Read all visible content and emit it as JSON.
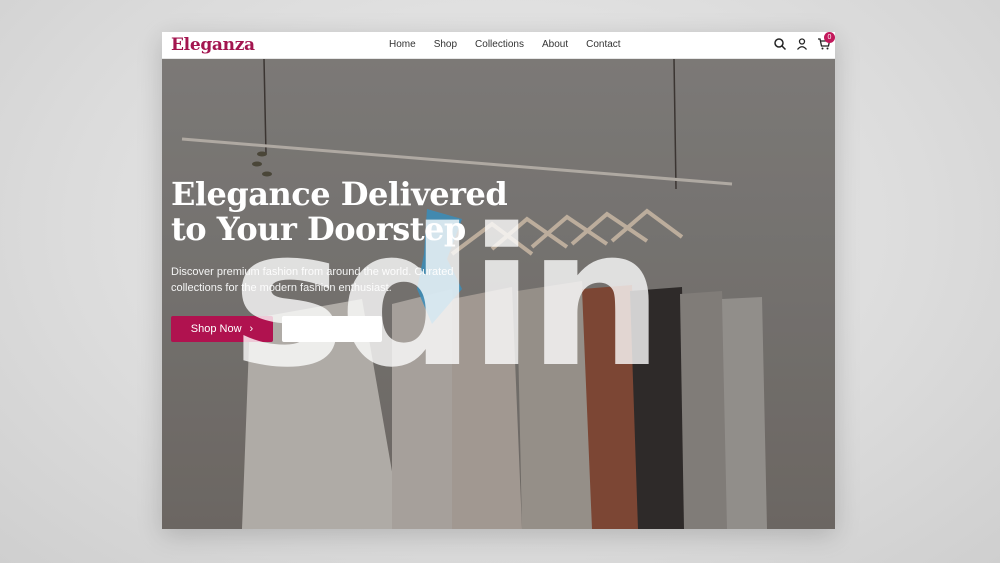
{
  "brand": {
    "name": "Eleganza",
    "color": "#a3154f"
  },
  "nav": {
    "items": [
      "Home",
      "Shop",
      "Collections",
      "About",
      "Contact"
    ],
    "icons": [
      "search-icon",
      "user-icon",
      "cart-icon"
    ],
    "cart_count": "0"
  },
  "hero": {
    "headline": "Elegance Delivered to Your Doorstep",
    "subtext": "Discover premium fashion from around the world. Curated collections for the modern fashion enthusiast.",
    "primary_button": "Shop Now",
    "primary_button_icon": "chevron-right-icon",
    "accent_color": "#b0124f"
  },
  "overlay": {
    "watermark_text": "sdin"
  }
}
